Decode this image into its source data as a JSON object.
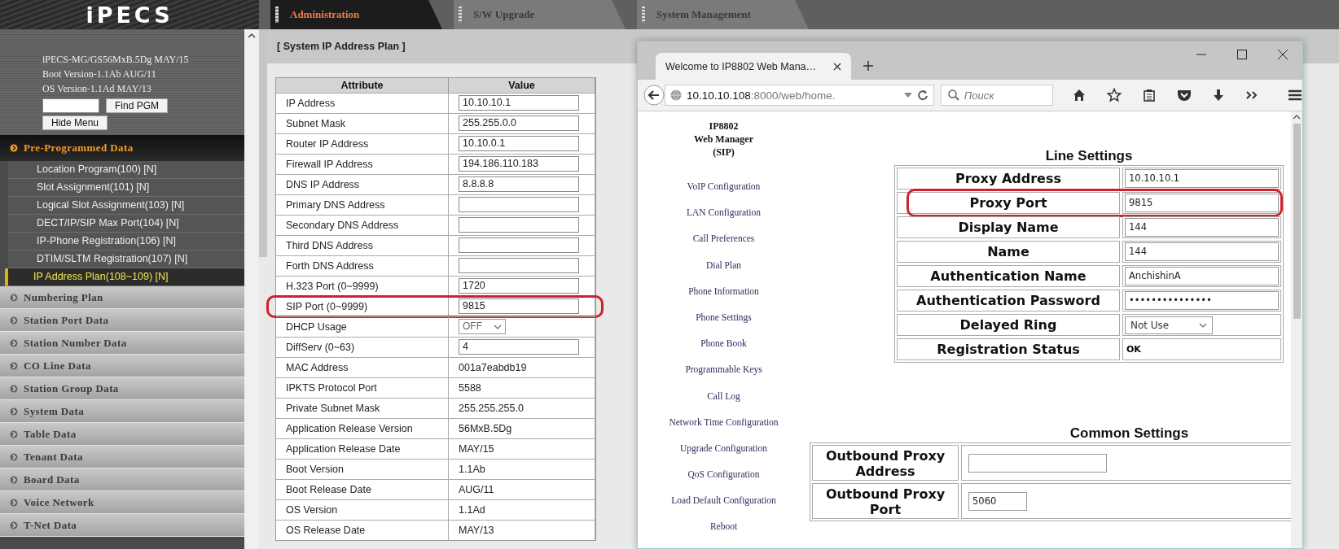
{
  "logo": "iPECS",
  "top_tabs": [
    {
      "label": "Administration",
      "selected": true
    },
    {
      "label": "S/W Upgrade",
      "selected": false
    },
    {
      "label": "System Management",
      "selected": false
    }
  ],
  "sidebar": {
    "info_lines": [
      "iPECS-MG/GS56MxB.5Dg MAY/15",
      "Boot Version-1.1Ab AUG/11",
      "OS Version-1.1Ad MAY/13"
    ],
    "find_button": "Find PGM",
    "hide_button": "Hide Menu",
    "sections": [
      {
        "label": "Pre-Programmed Data",
        "expanded": true,
        "children": [
          {
            "label": "Location Program(100) [N]",
            "selected": false
          },
          {
            "label": "Slot Assignment(101) [N]",
            "selected": false
          },
          {
            "label": "Logical Slot Assignment(103) [N]",
            "selected": false
          },
          {
            "label": "DECT/IP/SIP Max Port(104) [N]",
            "selected": false
          },
          {
            "label": "IP-Phone Registration(106) [N]",
            "selected": false
          },
          {
            "label": "DTIM/SLTM Registration(107) [N]",
            "selected": false
          },
          {
            "label": "IP Address Plan(108~109) [N]",
            "selected": true
          }
        ]
      },
      {
        "label": "Numbering Plan",
        "expanded": false
      },
      {
        "label": "Station Port Data",
        "expanded": false
      },
      {
        "label": "Station Number Data",
        "expanded": false
      },
      {
        "label": "CO Line Data",
        "expanded": false
      },
      {
        "label": "Station Group Data",
        "expanded": false
      },
      {
        "label": "System Data",
        "expanded": false
      },
      {
        "label": "Table Data",
        "expanded": false
      },
      {
        "label": "Tenant Data",
        "expanded": false
      },
      {
        "label": "Board Data",
        "expanded": false
      },
      {
        "label": "Voice Network",
        "expanded": false
      },
      {
        "label": "T-Net Data",
        "expanded": false
      }
    ]
  },
  "panel": {
    "title": "[ System IP Address Plan ]",
    "columns": [
      "Attribute",
      "Value"
    ],
    "rows": [
      {
        "attribute": "IP Address",
        "kind": "input",
        "value": "10.10.10.1",
        "highlighted": false
      },
      {
        "attribute": "Subnet Mask",
        "kind": "input",
        "value": "255.255.0.0",
        "highlighted": false
      },
      {
        "attribute": "Router IP Address",
        "kind": "input",
        "value": "10.10.0.1",
        "highlighted": false
      },
      {
        "attribute": "Firewall IP Address",
        "kind": "input",
        "value": "194.186.110.183",
        "highlighted": false
      },
      {
        "attribute": "DNS IP Address",
        "kind": "input",
        "value": "8.8.8.8",
        "highlighted": false
      },
      {
        "attribute": "Primary DNS Address",
        "kind": "input",
        "highlighted": false
      },
      {
        "attribute": "Secondary DNS Address",
        "kind": "input",
        "highlighted": false
      },
      {
        "attribute": "Third DNS Address",
        "kind": "input",
        "highlighted": false
      },
      {
        "attribute": "Forth DNS Address",
        "kind": "input",
        "highlighted": false
      },
      {
        "attribute": "H.323 Port (0~9999)",
        "kind": "input",
        "value": "1720",
        "highlighted": false
      },
      {
        "attribute": "SIP Port (0~9999)",
        "kind": "input",
        "value": "9815",
        "highlighted": true
      },
      {
        "attribute": "DHCP Usage",
        "kind": "select",
        "value": "OFF",
        "highlighted": false
      },
      {
        "attribute": "DiffServ (0~63)",
        "kind": "input",
        "value": "4",
        "highlighted": false
      },
      {
        "attribute": "MAC Address",
        "kind": "text",
        "value": "001a7eabdb19",
        "highlighted": false
      },
      {
        "attribute": "IPKTS Protocol Port",
        "kind": "text",
        "value": "5588",
        "highlighted": false
      },
      {
        "attribute": "Private Subnet Mask",
        "kind": "text",
        "value": "255.255.255.0",
        "highlighted": false
      },
      {
        "attribute": "Application Release Version",
        "kind": "text",
        "value": "56MxB.5Dg",
        "highlighted": false
      },
      {
        "attribute": "Application Release Date",
        "kind": "text",
        "value": "MAY/15",
        "highlighted": false
      },
      {
        "attribute": "Boot Version",
        "kind": "text",
        "value": "1.1Ab",
        "highlighted": false
      },
      {
        "attribute": "Boot Release Date",
        "kind": "text",
        "value": "AUG/11",
        "highlighted": false
      },
      {
        "attribute": "OS Version",
        "kind": "text",
        "value": "1.1Ad",
        "highlighted": false
      },
      {
        "attribute": "OS Release Date",
        "kind": "text",
        "value": "MAY/13",
        "highlighted": false
      }
    ]
  },
  "browser": {
    "tab_title": "Welcome to IP8802 Web Mana…",
    "url_host": "10.10.10.108",
    "url_rest": ":8000/web/home.",
    "search": {
      "placeholder": "Поиск"
    },
    "page": {
      "brand": [
        "IP8802",
        "Web Manager",
        "(SIP)"
      ],
      "nav": [
        "VoIP Configuration",
        "LAN Configuration",
        "Call Preferences",
        "Dial Plan",
        "Phone Information",
        "Phone Settings",
        "Phone Book",
        "Programmable Keys",
        "Call Log",
        "Network Time Configuration",
        "Upgrade Configuration",
        "QoS Configuration",
        "Load Default Configuration",
        "Reboot"
      ],
      "line_settings": {
        "title": "Line Settings",
        "rows": [
          {
            "label": "Proxy Address",
            "kind": "input",
            "value": "10.10.10.1",
            "highlighted": false
          },
          {
            "label": "Proxy Port",
            "kind": "input",
            "value": "9815",
            "highlighted": true
          },
          {
            "label": "Display Name",
            "kind": "input",
            "value": "144",
            "highlighted": false
          },
          {
            "label": "Name",
            "kind": "input",
            "value": "144",
            "highlighted": false
          },
          {
            "label": "Authentication Name",
            "kind": "input",
            "value": "AnchishinA",
            "highlighted": false
          },
          {
            "label": "Authentication Password",
            "kind": "input",
            "value": "•••••••••••••••",
            "highlighted": false
          },
          {
            "label": "Delayed Ring",
            "kind": "select",
            "value": "Not Use",
            "highlighted": false
          },
          {
            "label": "Registration Status",
            "kind": "text",
            "value": "OK",
            "highlighted": false
          }
        ]
      },
      "common_settings": {
        "title": "Common Settings",
        "rows": [
          {
            "label": "Outbound Proxy Address",
            "kind": "input"
          },
          {
            "label": "Outbound Proxy Port",
            "kind": "short",
            "value": "5060"
          }
        ]
      }
    }
  }
}
